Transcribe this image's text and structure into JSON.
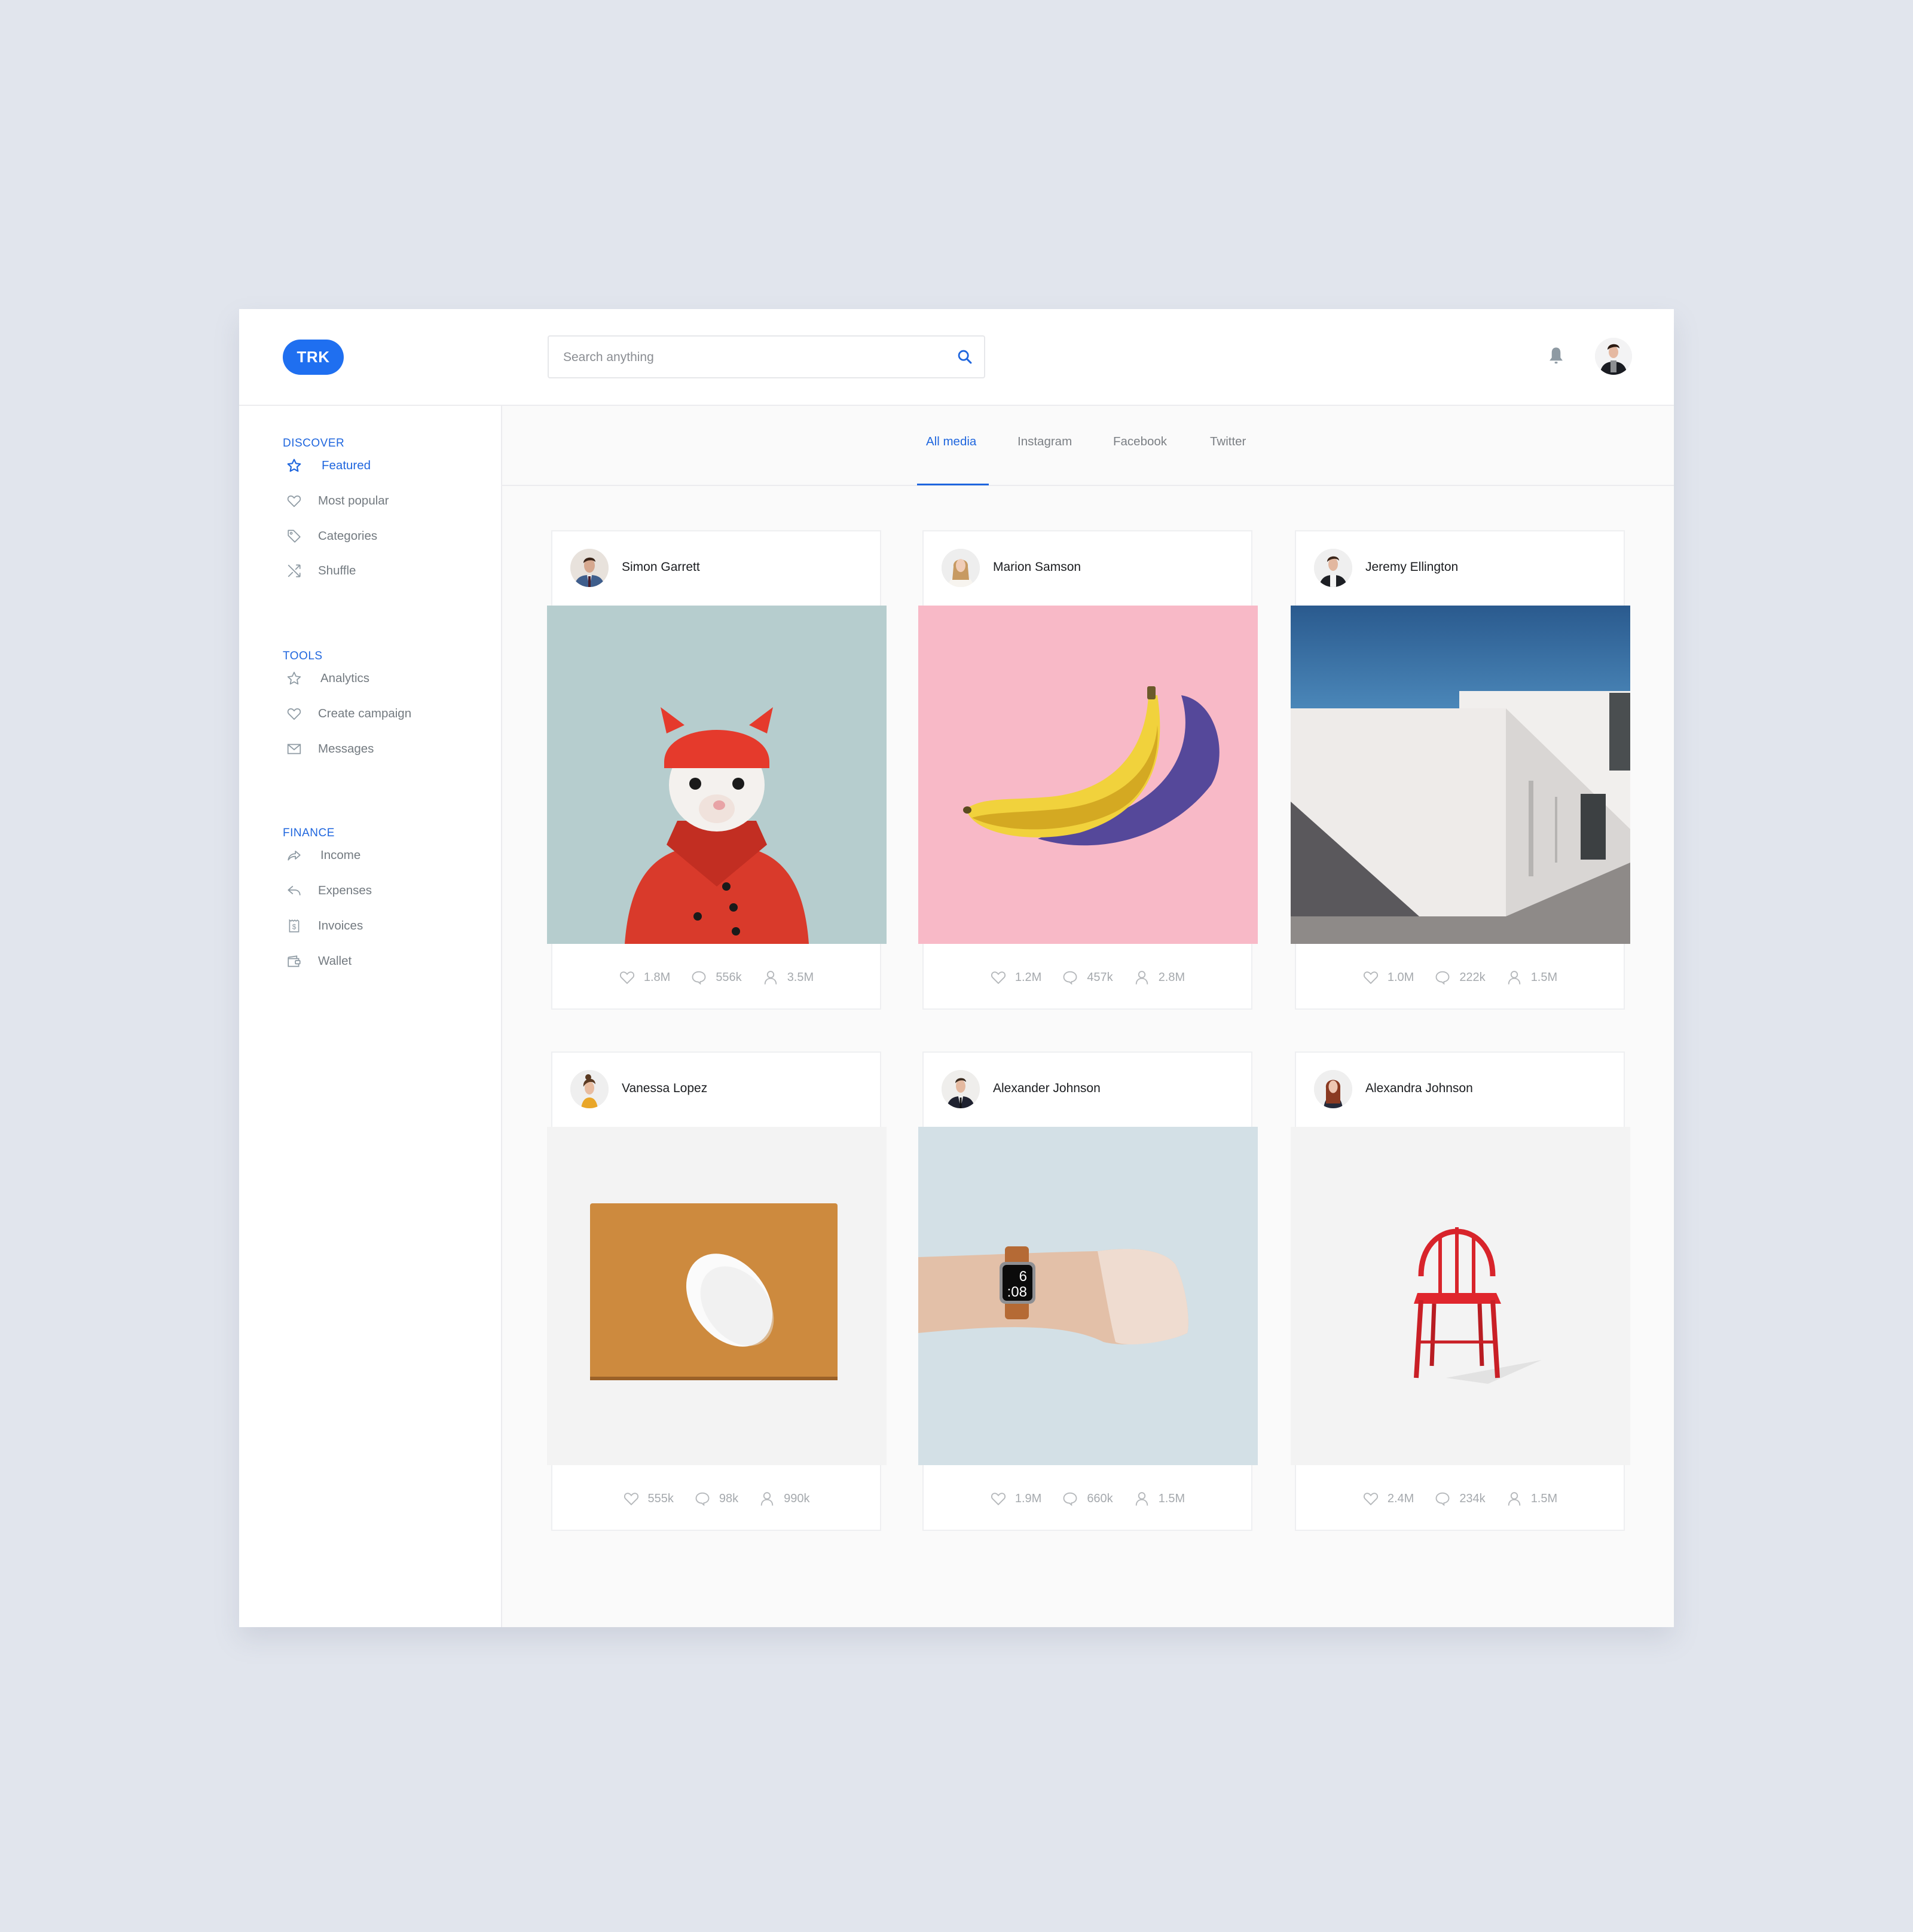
{
  "header": {
    "logo": "TRK",
    "search_placeholder": "Search anything",
    "search_value": "",
    "icons": {
      "search": "search-icon",
      "notifications": "bell-icon",
      "profile": "avatar"
    }
  },
  "sidebar": {
    "sections": [
      {
        "title": "DISCOVER",
        "items": [
          {
            "label": "Featured",
            "icon": "star-icon",
            "active": true
          },
          {
            "label": "Most popular",
            "icon": "heart-icon"
          },
          {
            "label": "Categories",
            "icon": "tag-icon"
          },
          {
            "label": "Shuffle",
            "icon": "shuffle-icon"
          }
        ]
      },
      {
        "title": "TOOLS",
        "items": [
          {
            "label": "Analytics",
            "icon": "star-icon"
          },
          {
            "label": "Create campaign",
            "icon": "heart-icon"
          },
          {
            "label": "Messages",
            "icon": "envelope-icon"
          }
        ]
      },
      {
        "title": "FINANCE",
        "items": [
          {
            "label": "Income",
            "icon": "forward-arrow-icon"
          },
          {
            "label": "Expenses",
            "icon": "reply-arrow-icon"
          },
          {
            "label": "Invoices",
            "icon": "receipt-icon"
          },
          {
            "label": "Wallet",
            "icon": "wallet-icon"
          }
        ]
      }
    ]
  },
  "tabs": [
    {
      "label": "All media",
      "active": true
    },
    {
      "label": "Instagram"
    },
    {
      "label": "Facebook"
    },
    {
      "label": "Twitter"
    }
  ],
  "cards": [
    {
      "author": "Simon Garrett",
      "image": "ermine-in-red-coat",
      "likes": "1.8M",
      "comments": "556k",
      "followers": "3.5M"
    },
    {
      "author": "Marion Samson",
      "image": "banana-on-pink",
      "likes": "1.2M",
      "comments": "457k",
      "followers": "2.8M"
    },
    {
      "author": "Jeremy Ellington",
      "image": "white-building",
      "likes": "1.0M",
      "comments": "222k",
      "followers": "1.5M"
    },
    {
      "author": "Vanessa Lopez",
      "image": "mouse-on-leather-pad",
      "likes": "555k",
      "comments": "98k",
      "followers": "990k"
    },
    {
      "author": "Alexander Johnson",
      "image": "wrist-watch",
      "watch_time_hour": "6",
      "watch_time_min": ":08",
      "likes": "1.9M",
      "comments": "660k",
      "followers": "1.5M"
    },
    {
      "author": "Alexandra Johnson",
      "image": "red-chair",
      "likes": "2.4M",
      "comments": "234k",
      "followers": "1.5M"
    }
  ],
  "colors": {
    "accent": "#1f66de",
    "logo": "#1f6ff0",
    "background": "#e1e5ed"
  }
}
